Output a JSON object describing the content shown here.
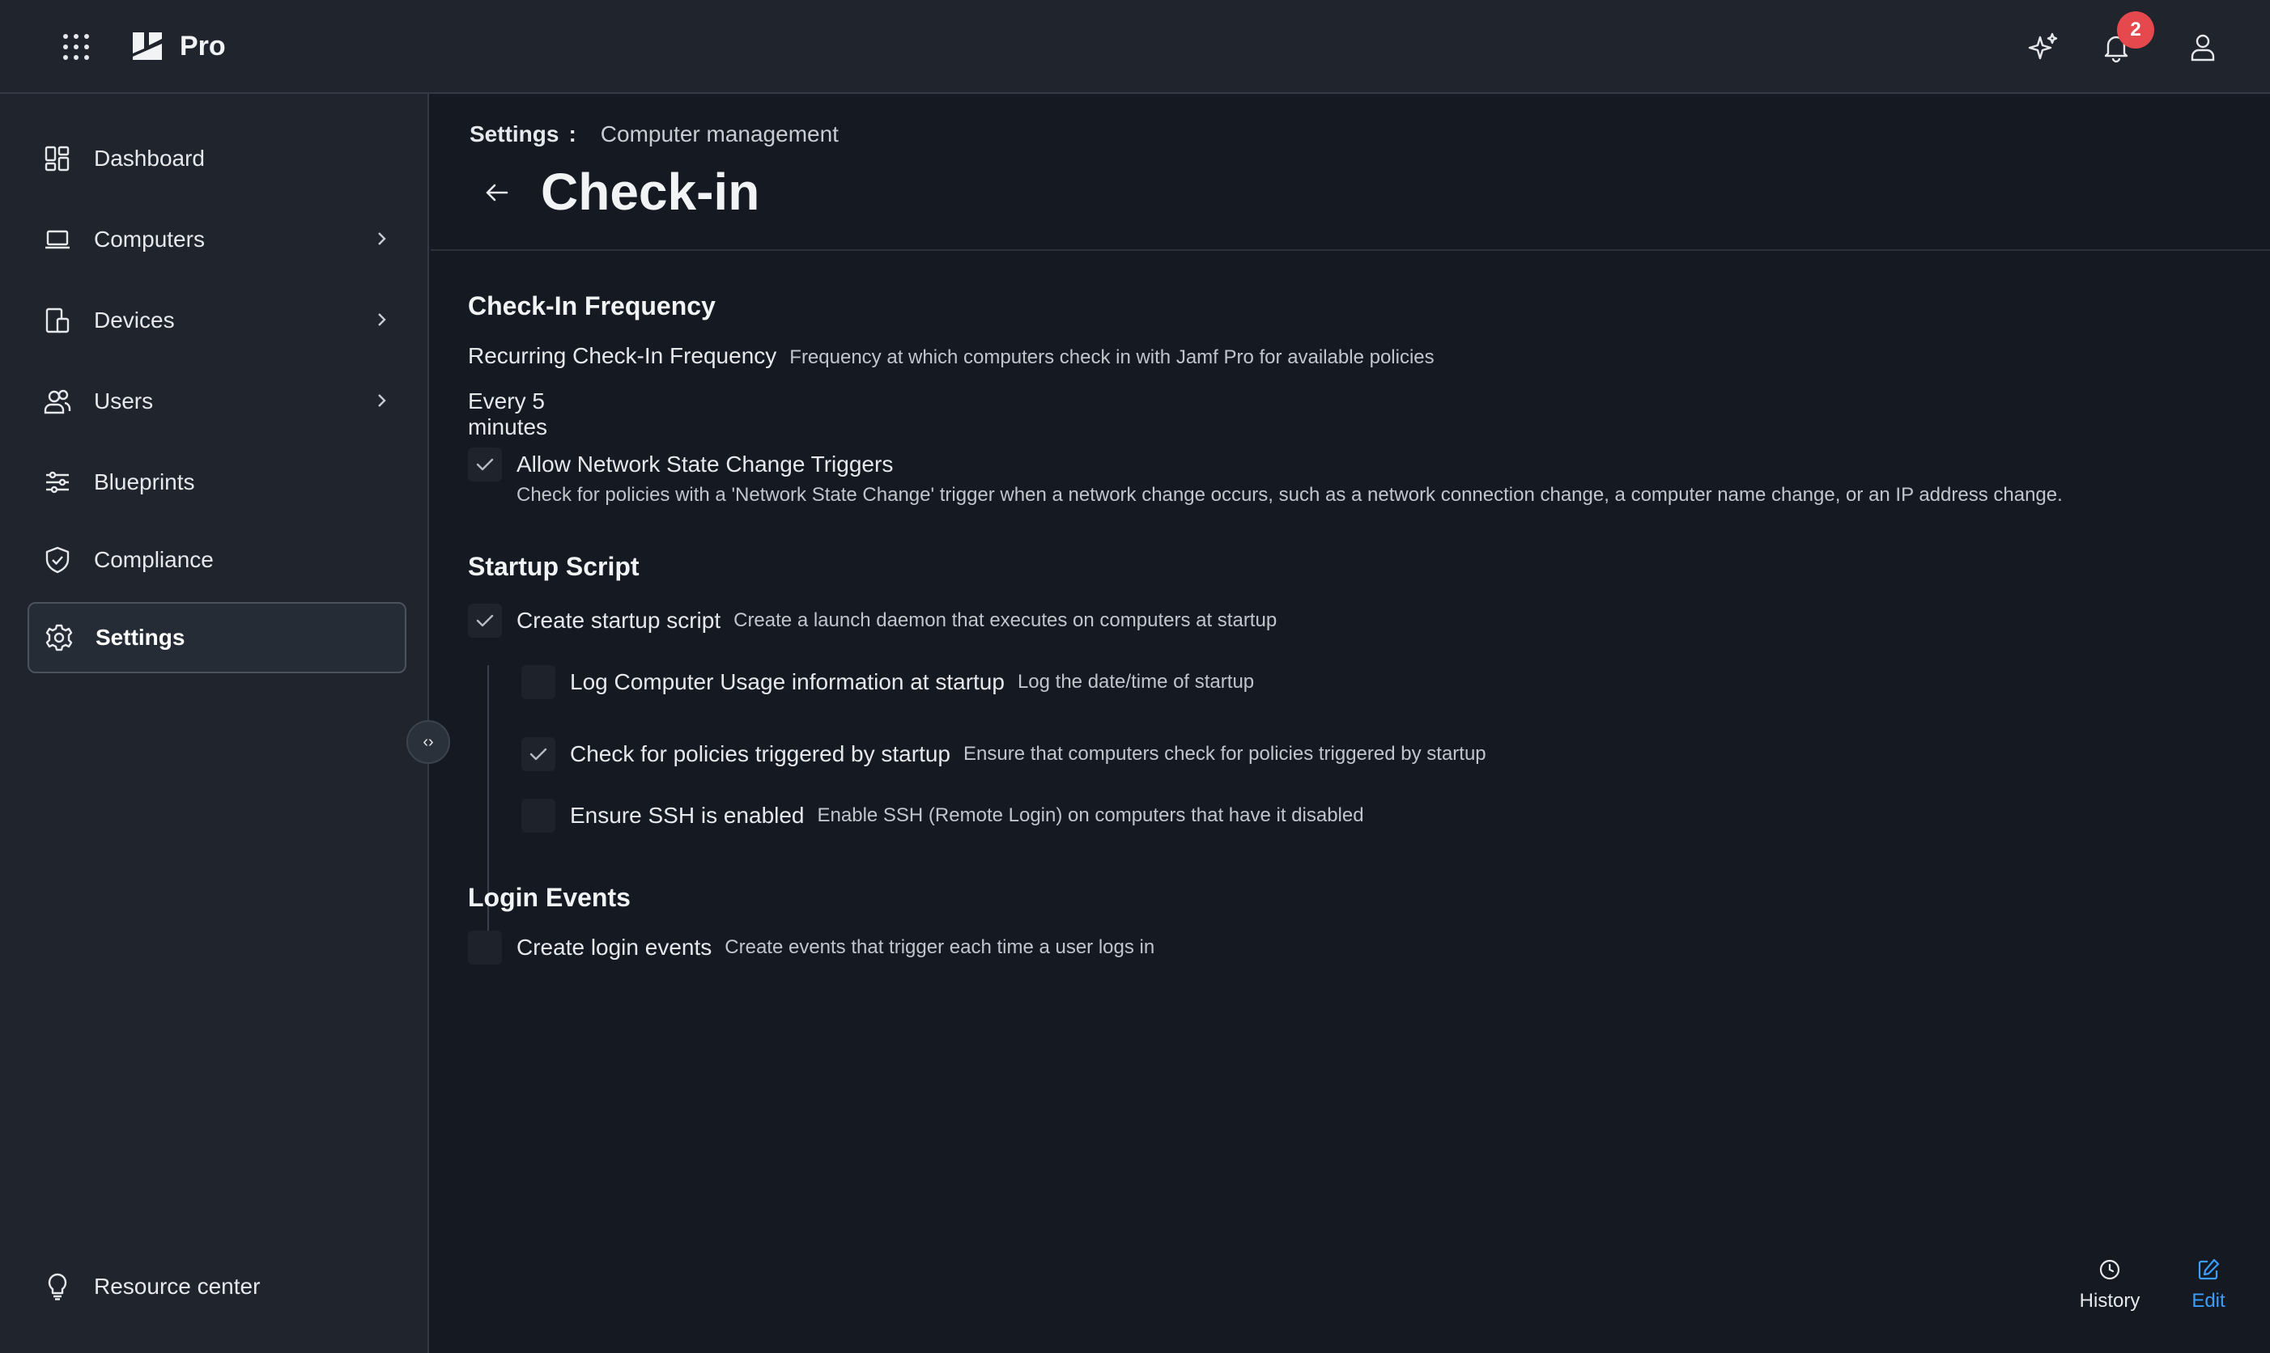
{
  "topbar": {
    "brand": "Pro",
    "notification_count": "2"
  },
  "sidebar": {
    "items": [
      {
        "label": "Dashboard"
      },
      {
        "label": "Computers"
      },
      {
        "label": "Devices"
      },
      {
        "label": "Users"
      },
      {
        "label": "Blueprints"
      },
      {
        "label": "Compliance"
      },
      {
        "label": "Settings"
      }
    ],
    "resource_center": "Resource center",
    "collapse_glyph": "‹›"
  },
  "header": {
    "breadcrumb_root": "Settings",
    "breadcrumb_sep": ":",
    "breadcrumb_current": "Computer management",
    "title": "Check-in"
  },
  "checkin_frequency": {
    "title": "Check-In Frequency",
    "label": "Recurring Check-In Frequency",
    "desc": "Frequency at which computers check in with Jamf Pro for available policies",
    "value": "Every 5 minutes",
    "network_label": "Allow Network State Change Triggers",
    "network_checked": true,
    "network_desc": "Check for policies with a 'Network State Change' trigger when a network change occurs, such as a network connection change, a computer name change, or an IP address change."
  },
  "startup_script": {
    "title": "Startup Script",
    "create_label": "Create startup script",
    "create_desc": "Create a launch daemon that executes on computers at startup",
    "create_checked": true,
    "sub_items": [
      {
        "label": "Log Computer Usage information at startup",
        "desc": "Log the date/time of startup",
        "checked": false
      },
      {
        "label": "Check for policies triggered by startup",
        "desc": "Ensure that computers check for policies triggered by startup",
        "checked": true
      },
      {
        "label": "Ensure SSH is enabled",
        "desc": "Enable SSH (Remote Login) on computers that have it disabled",
        "checked": false
      }
    ]
  },
  "login_events": {
    "title": "Login Events",
    "label": "Create login events",
    "desc": "Create events that trigger each time a user logs in",
    "checked": false
  },
  "actions": {
    "history": "History",
    "edit": "Edit",
    "edit_color": "#3b9eff"
  }
}
